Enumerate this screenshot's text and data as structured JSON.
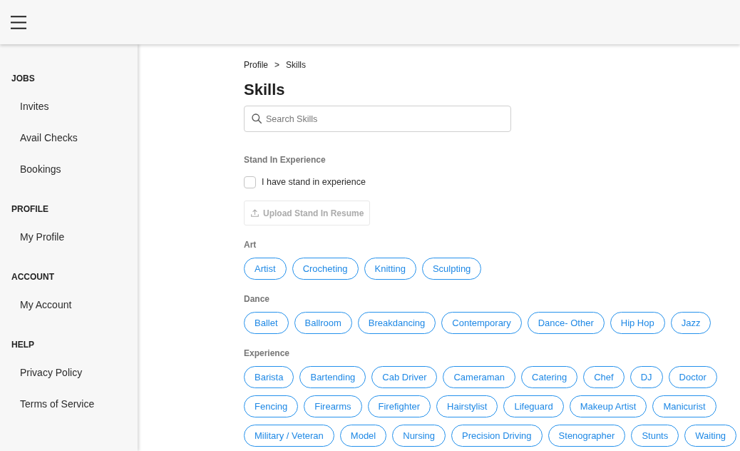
{
  "sidebar": {
    "groups": [
      {
        "heading": "JOBS",
        "items": [
          {
            "label": "Invites",
            "selected": false
          },
          {
            "label": "Avail Checks",
            "selected": false
          },
          {
            "label": "Bookings",
            "selected": false
          }
        ]
      },
      {
        "heading": "PROFILE",
        "items": [
          {
            "label": "My Profile",
            "selected": false
          }
        ]
      },
      {
        "heading": "ACCOUNT",
        "items": [
          {
            "label": "My Account",
            "selected": false
          }
        ]
      },
      {
        "heading": "HELP",
        "items": [
          {
            "label": "Privacy Policy",
            "selected": false
          },
          {
            "label": "Terms of Service",
            "selected": false
          }
        ]
      }
    ]
  },
  "breadcrumb": {
    "items": [
      "Profile",
      "Skills"
    ],
    "separator": ">"
  },
  "title": "Skills",
  "search": {
    "placeholder": "Search Skills"
  },
  "stand_in": {
    "heading": "Stand In Experience",
    "checkbox": {
      "label": "I have stand in experience",
      "checked": false
    },
    "upload_button": {
      "label": "Upload Stand In Resume",
      "disabled": true
    }
  },
  "categories": [
    {
      "name": "Art",
      "chips": [
        {
          "label": "Artist",
          "selected": false
        },
        {
          "label": "Crocheting",
          "selected": false
        },
        {
          "label": "Knitting",
          "selected": false
        },
        {
          "label": "Sculpting",
          "selected": false
        }
      ]
    },
    {
      "name": "Dance",
      "chips": [
        {
          "label": "Ballet",
          "selected": false
        },
        {
          "label": "Ballroom",
          "selected": false
        },
        {
          "label": "Breakdancing",
          "selected": false
        },
        {
          "label": "Contemporary",
          "selected": false
        },
        {
          "label": "Dance- Other",
          "selected": false
        },
        {
          "label": "Hip Hop",
          "selected": false
        },
        {
          "label": "Jazz",
          "selected": false
        }
      ]
    },
    {
      "name": "Experience",
      "chips": [
        {
          "label": "Barista",
          "selected": false
        },
        {
          "label": "Bartending",
          "selected": false
        },
        {
          "label": "Cab Driver",
          "selected": false
        },
        {
          "label": "Cameraman",
          "selected": false
        },
        {
          "label": "Catering",
          "selected": false
        },
        {
          "label": "Chef",
          "selected": false
        },
        {
          "label": "DJ",
          "selected": false
        },
        {
          "label": "Doctor",
          "selected": false
        },
        {
          "label": "Fencing",
          "selected": false
        },
        {
          "label": "Firearms",
          "selected": false
        },
        {
          "label": "Firefighter",
          "selected": false
        },
        {
          "label": "Hairstylist",
          "selected": false
        },
        {
          "label": "Lifeguard",
          "selected": false
        },
        {
          "label": "Makeup Artist",
          "selected": false
        },
        {
          "label": "Manicurist",
          "selected": false
        },
        {
          "label": "Military / Veteran",
          "selected": false
        },
        {
          "label": "Model",
          "selected": false
        },
        {
          "label": "Nursing",
          "selected": false
        },
        {
          "label": "Precision Driving",
          "selected": false
        },
        {
          "label": "Stenographer",
          "selected": false
        },
        {
          "label": "Stunts",
          "selected": false
        },
        {
          "label": "Waiting",
          "selected": false
        }
      ]
    }
  ]
}
